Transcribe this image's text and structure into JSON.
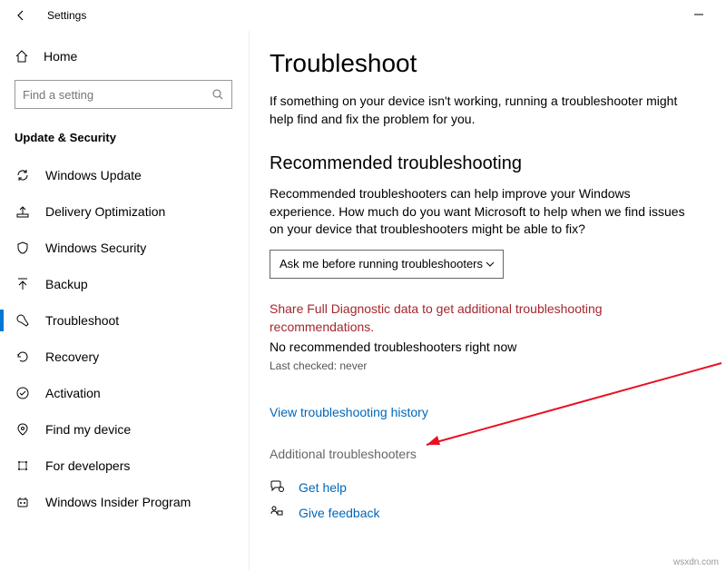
{
  "titlebar": {
    "title": "Settings"
  },
  "sidebar": {
    "home": "Home",
    "search_placeholder": "Find a setting",
    "section": "Update & Security",
    "items": [
      {
        "label": "Windows Update"
      },
      {
        "label": "Delivery Optimization"
      },
      {
        "label": "Windows Security"
      },
      {
        "label": "Backup"
      },
      {
        "label": "Troubleshoot"
      },
      {
        "label": "Recovery"
      },
      {
        "label": "Activation"
      },
      {
        "label": "Find my device"
      },
      {
        "label": "For developers"
      },
      {
        "label": "Windows Insider Program"
      }
    ]
  },
  "main": {
    "title": "Troubleshoot",
    "intro": "If something on your device isn't working, running a troubleshooter might help find and fix the problem for you.",
    "rec_heading": "Recommended troubleshooting",
    "rec_desc": "Recommended troubleshooters can help improve your Windows experience. How much do you want Microsoft to help when we find issues on your device that troubleshooters might be able to fix?",
    "dropdown_value": "Ask me before running troubleshooters",
    "diag_link": "Share Full Diagnostic data to get additional troubleshooting recommendations.",
    "no_rec": "No recommended troubleshooters right now",
    "last_checked": "Last checked: never",
    "history_link": "View troubleshooting history",
    "additional": "Additional troubleshooters",
    "get_help": "Get help",
    "give_feedback": "Give feedback"
  },
  "watermark": "wsxdn.com"
}
